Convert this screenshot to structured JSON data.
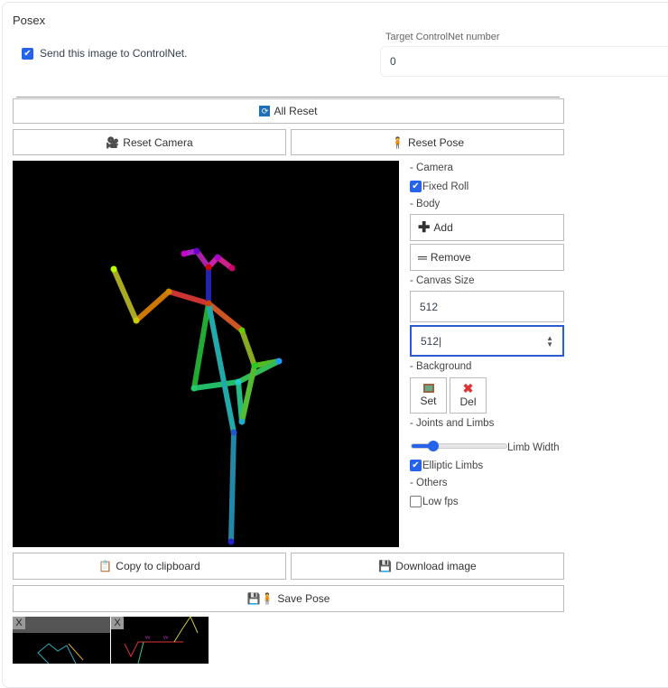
{
  "title": "Posex",
  "send_checkbox": {
    "label": "Send this image to ControlNet.",
    "checked": true
  },
  "target": {
    "label": "Target ControlNet number",
    "value": "0"
  },
  "buttons": {
    "all_reset": "All Reset",
    "reset_camera": "Reset Camera",
    "reset_pose": "Reset Pose",
    "copy": "Copy to clipboard",
    "download": "Download image",
    "save_pose": "Save Pose"
  },
  "side": {
    "camera": "- Camera",
    "fixed_roll": "Fixed Roll",
    "body": "- Body",
    "add": "Add",
    "remove": "Remove",
    "canvas_size": "- Canvas Size",
    "width": "512",
    "height": "512",
    "background": "- Background",
    "set": "Set",
    "del": "Del",
    "joints": "- Joints and Limbs",
    "limb_width": "Limb Width",
    "limb_width_value": 0.2,
    "elliptic": "Elliptic Limbs",
    "others": "- Others",
    "low_fps": "Low fps"
  },
  "thumb_close": "X",
  "colors": {
    "accent": "#2563eb"
  }
}
